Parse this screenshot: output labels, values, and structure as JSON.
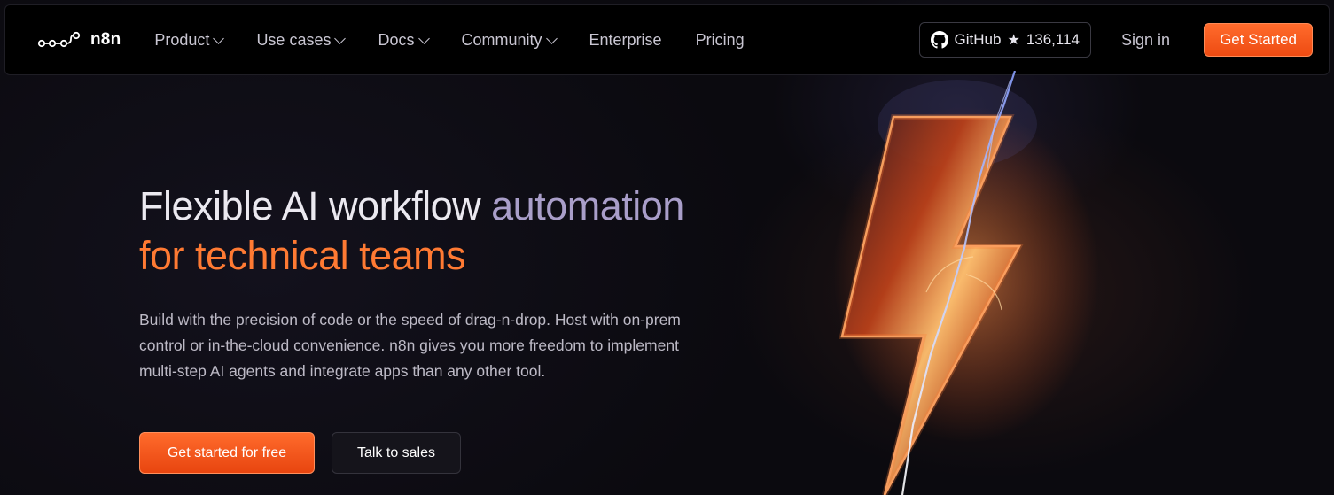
{
  "brand": {
    "name": "n8n"
  },
  "nav": {
    "items": [
      {
        "label": "Product",
        "dropdown": true
      },
      {
        "label": "Use cases",
        "dropdown": true
      },
      {
        "label": "Docs",
        "dropdown": true
      },
      {
        "label": "Community",
        "dropdown": true
      },
      {
        "label": "Enterprise",
        "dropdown": false
      },
      {
        "label": "Pricing",
        "dropdown": false
      }
    ],
    "github_label": "GitHub",
    "github_stars": "136,114",
    "sign_in": "Sign in",
    "get_started": "Get Started"
  },
  "hero": {
    "title_part1": "Flexible AI workflow ",
    "title_part2": "automation",
    "title_part3": "for technical teams",
    "description": "Build with the precision of code or the speed of drag-n-drop. Host with on-prem control or in-the-cloud convenience. n8n gives you more freedom to implement multi-step AI agents and integrate apps than any other tool.",
    "primary_cta": "Get started for free",
    "secondary_cta": "Talk to sales"
  },
  "colors": {
    "accent": "#ff6b2c",
    "title_highlight": "#a99ec9",
    "title_orange": "#ff7a33",
    "background": "#0b0a0f"
  },
  "icons": [
    "n8n-logo-icon",
    "chevron-down-icon",
    "github-icon",
    "star-icon",
    "lightning-bolt-graphic"
  ]
}
